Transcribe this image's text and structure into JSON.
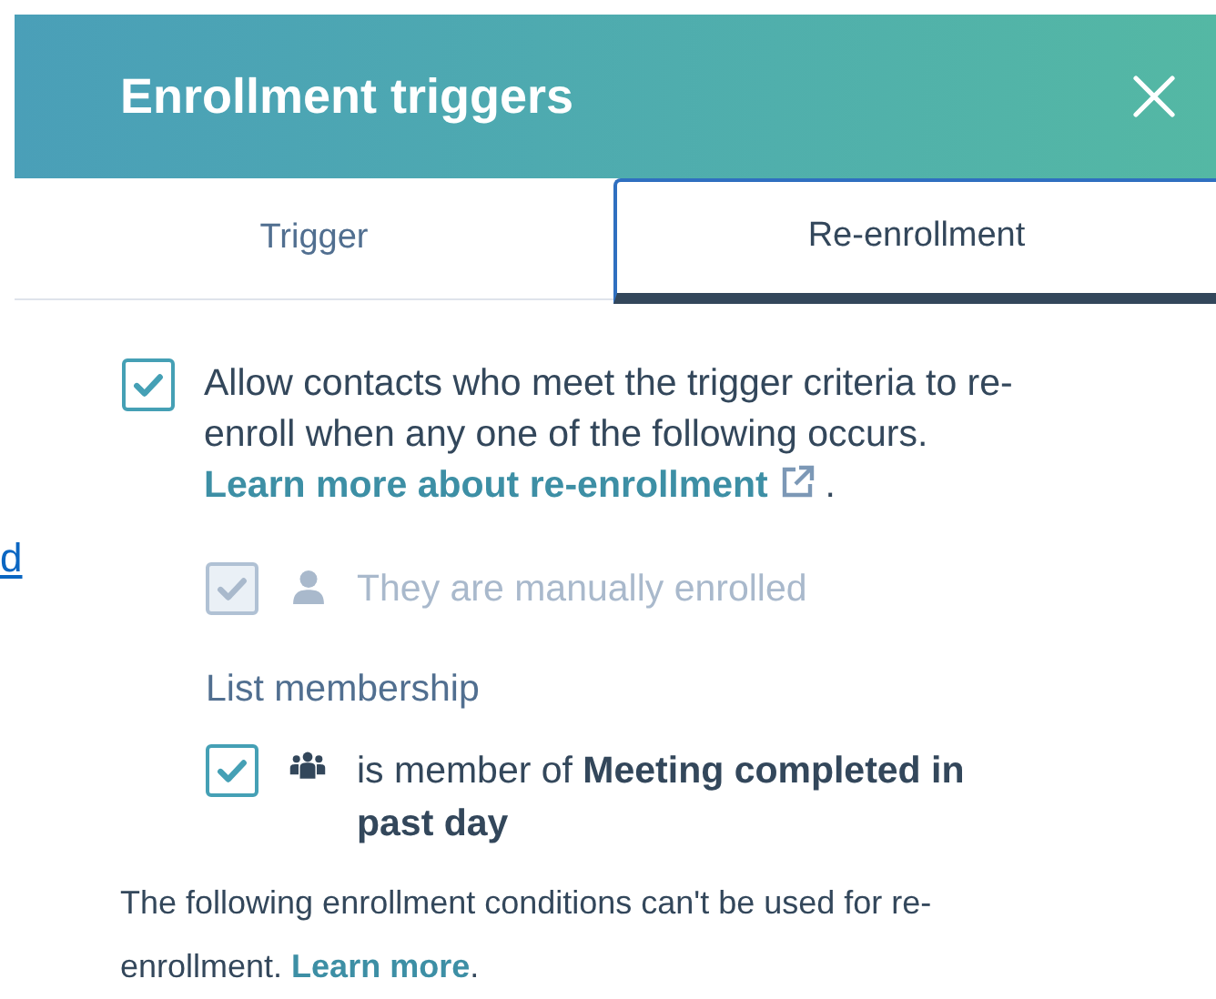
{
  "background_link": "d",
  "window": {
    "title": "Enrollment triggers"
  },
  "tabs": [
    {
      "label": "Trigger",
      "selected": false
    },
    {
      "label": "Re-enrollment",
      "selected": true
    }
  ],
  "reenroll": {
    "checked": true,
    "text": "Allow contacts who meet the trigger criteria to re-enroll when any one of the following occurs.",
    "link": "Learn more about re-enrollment",
    "after": "."
  },
  "conditions": [
    {
      "kind": "person",
      "checked": true,
      "disabled": true,
      "text": "They are manually enrolled"
    },
    {
      "kind": "group",
      "heading": "List membership",
      "checked": true,
      "disabled": false,
      "text": "is member of **Meeting completed in past day**"
    }
  ],
  "footer": {
    "text": "The following enrollment conditions can't be used for re-enrollment.",
    "link": "Learn more",
    "after": "."
  }
}
